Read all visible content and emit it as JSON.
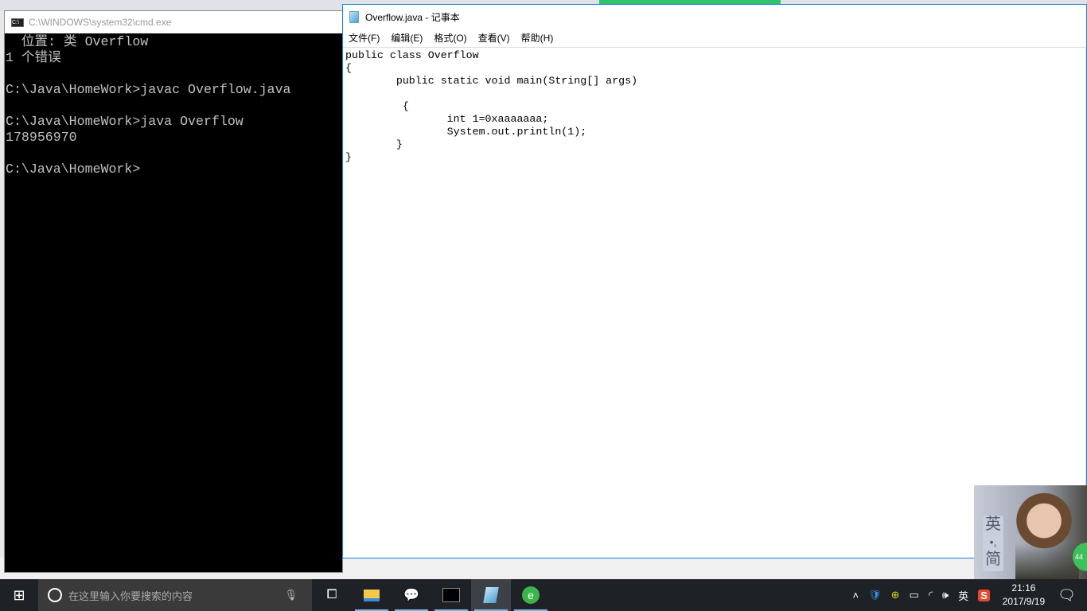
{
  "cmd": {
    "title": "C:\\WINDOWS\\system32\\cmd.exe",
    "lines": [
      "  位置: 类 Overflow",
      "1 个错误",
      "",
      "C:\\Java\\HomeWork>javac Overflow.java",
      "",
      "C:\\Java\\HomeWork>java Overflow",
      "178956970",
      "",
      "C:\\Java\\HomeWork>"
    ]
  },
  "notepad": {
    "title": "Overflow.java - 记事本",
    "menu": [
      "文件(F)",
      "编辑(E)",
      "格式(O)",
      "查看(V)",
      "帮助(H)"
    ],
    "content": "public class Overflow\n{\n\tpublic static void main(String[] args)\n\n\t {\n\t\tint 1=0xaaaaaaa;\n\t\tSystem.out.println(1);\n\t}\n}"
  },
  "ime": {
    "lang": "英",
    "mode": "简",
    "badge": "44"
  },
  "taskbar": {
    "search_placeholder": "在这里输入你要搜索的内容",
    "tray_lang": "英",
    "time": "21:16",
    "date": "2017/9/19"
  }
}
